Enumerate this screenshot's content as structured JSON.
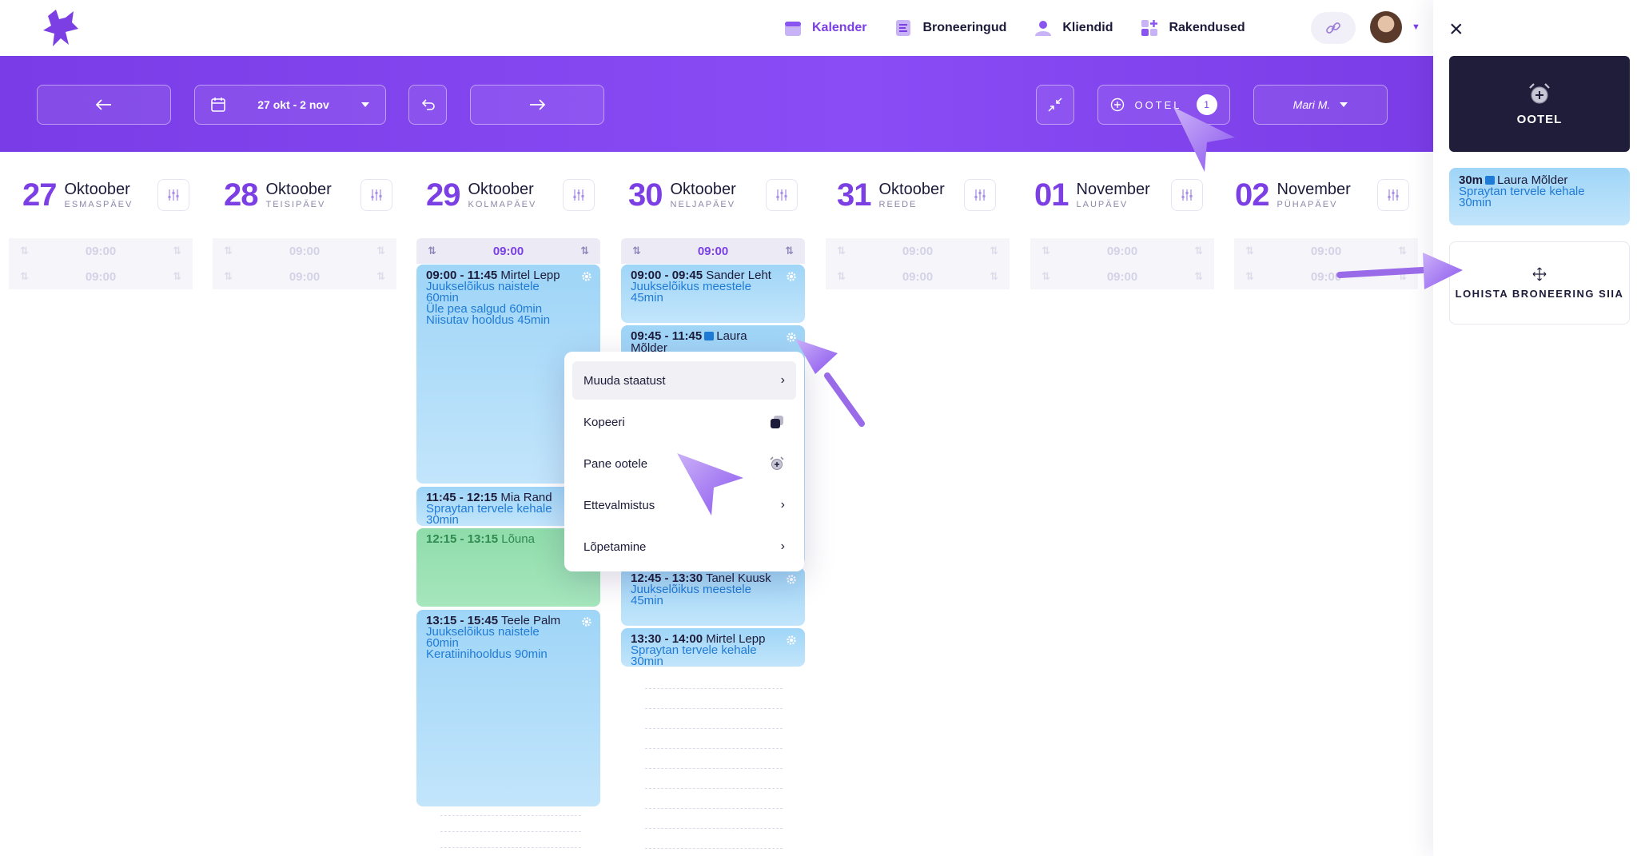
{
  "nav": {
    "items": [
      {
        "label": "Kalender",
        "icon": "calendar-icon",
        "active": true
      },
      {
        "label": "Broneeringud",
        "icon": "list-icon",
        "active": false
      },
      {
        "label": "Kliendid",
        "icon": "users-icon",
        "active": false
      },
      {
        "label": "Rakendused",
        "icon": "apps-icon",
        "active": false
      }
    ]
  },
  "toolbar": {
    "date_range": "27 okt - 2 nov",
    "ootel_label": "OOTEL",
    "ootel_count": "1",
    "employee": "Mari M."
  },
  "days": [
    {
      "num": "27",
      "month": "Oktoober",
      "weekday": "ESMASPÄEV"
    },
    {
      "num": "28",
      "month": "Oktoober",
      "weekday": "TEISIPÄEV"
    },
    {
      "num": "29",
      "month": "Oktoober",
      "weekday": "KOLMAPÄEV"
    },
    {
      "num": "30",
      "month": "Oktoober",
      "weekday": "NELJAPÄEV"
    },
    {
      "num": "31",
      "month": "Oktoober",
      "weekday": "REEDE"
    },
    {
      "num": "01",
      "month": "November",
      "weekday": "LAUPÄEV"
    },
    {
      "num": "02",
      "month": "November",
      "weekday": "PÜHAPÄEV"
    }
  ],
  "slot_time": "09:00",
  "bookings": {
    "wed": [
      {
        "time": "09:00 - 11:45",
        "name": "Mirtel Lepp",
        "services": [
          "Juukselõikus naistele",
          "60min",
          "Üle pea salgud 60min",
          "Niisutav hooldus 45min"
        ]
      },
      {
        "time": "11:45 - 12:15",
        "name": "Mia Rand",
        "services": [
          "Spraytan tervele kehale",
          "30min"
        ]
      },
      {
        "time": "12:15 - 13:15",
        "name": "Lõuna",
        "services": []
      },
      {
        "time": "13:15 - 15:45",
        "name": "Teele Palm",
        "services": [
          "Juukselõikus naistele",
          "60min",
          "Keratiinihooldus 90min"
        ]
      }
    ],
    "thu": [
      {
        "time": "09:00 - 09:45",
        "name": "Sander Leht",
        "services": [
          "Juukselõikus meestele",
          "45min"
        ]
      },
      {
        "time": "09:45 - 11:45",
        "name": "Laura",
        "name2": "Mõlder",
        "services": []
      },
      {
        "time": "12:45 - 13:30",
        "name": "Tanel Kuusk",
        "services": [
          "Juukselõikus meestele",
          "45min"
        ]
      },
      {
        "time": "13:30 - 14:00",
        "name": "Mirtel Lepp",
        "services": [
          "Spraytan tervele kehale",
          "30min"
        ]
      }
    ]
  },
  "context_menu": {
    "items": [
      {
        "label": "Muuda staatust",
        "trail": "chevron"
      },
      {
        "label": "Kopeeri",
        "trail": "copy-icon"
      },
      {
        "label": "Pane ootele",
        "trail": "alarm-icon"
      },
      {
        "label": "Ettevalmistus",
        "trail": "chevron"
      },
      {
        "label": "Lõpetamine",
        "trail": "chevron"
      }
    ]
  },
  "panel": {
    "card_label": "OOTEL",
    "waiting": {
      "duration": "30m",
      "name": "Laura Mõlder",
      "services": [
        "Spraytan tervele kehale",
        "30min"
      ]
    },
    "dropzone_label": "LOHISTA BRONEERING SIIA"
  },
  "colors": {
    "accent": "#7b3fe4",
    "booking": "#a9d9f8",
    "lunch": "#96dfb0",
    "dark": "#1f1d3a"
  }
}
